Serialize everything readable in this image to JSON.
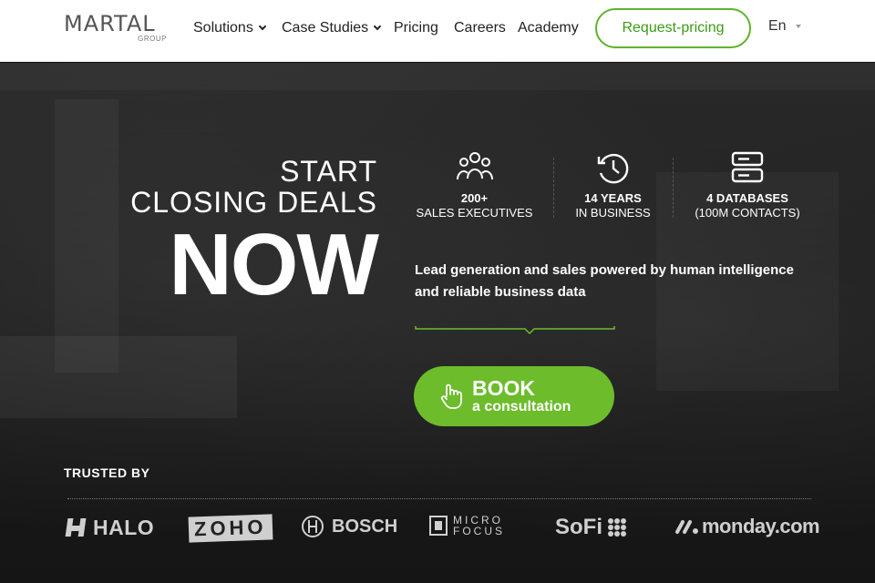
{
  "header": {
    "logo": {
      "word": "MARTAL",
      "sub": "GROUP"
    },
    "nav": [
      {
        "label": "Solutions",
        "dropdown": true
      },
      {
        "label": "Case Studies",
        "dropdown": true
      },
      {
        "label": "Pricing"
      },
      {
        "label": "Careers"
      },
      {
        "label": "Academy"
      }
    ],
    "cta": "Request-pricing",
    "language": "En"
  },
  "hero": {
    "line1": "START",
    "line2": "CLOSING DEALS",
    "line3": "NOW",
    "stats": [
      {
        "icon": "users-group-icon",
        "value": "200+",
        "label": "SALES EXECUTIVES"
      },
      {
        "icon": "history-clock-icon",
        "value": "14 YEARS",
        "label": "IN BUSINESS"
      },
      {
        "icon": "database-icon",
        "value": "4 DATABASES",
        "label": "(100M CONTACTS)"
      }
    ],
    "lead": "Lead generation and sales powered by human intelligence and reliable business data",
    "book_button": {
      "line1": "BOOK",
      "line2": "a consultation"
    }
  },
  "trusted": {
    "title": "TRUSTED BY",
    "brands": [
      "HALO",
      "ZOHO",
      "BOSCH",
      "MICRO FOCUS",
      "SoFi",
      "monday.com"
    ]
  },
  "colors": {
    "accent": "#6cbc2c",
    "accent_dark": "#3e9a16",
    "hero_bg": "#1d1d1d"
  }
}
